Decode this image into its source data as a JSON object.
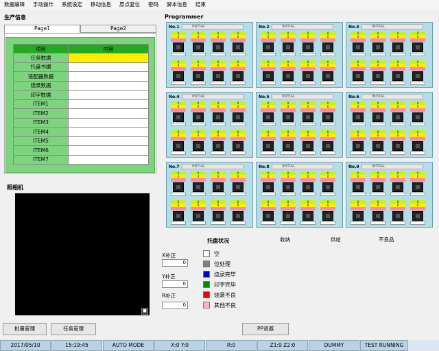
{
  "menu": [
    "数据编辑",
    "手动操作",
    "系统设定",
    "移动信息",
    "原点复位",
    "密码",
    "脚本信息",
    "结束"
  ],
  "production": {
    "title": "生产信息",
    "tabs": [
      "Page1",
      "Page2"
    ],
    "head_item": "项目",
    "head_content": "内容",
    "rows": [
      "任务数据",
      "托盘书据",
      "适配器数据",
      "烧录数据",
      "印字数据",
      "ITEM1",
      "ITEM2",
      "ITEM3",
      "ITEM4",
      "ITEM5",
      "ITEM6",
      "ITEM7"
    ]
  },
  "camera": {
    "title": "照相机",
    "icon": "save-icon"
  },
  "programmer": {
    "title": "Programmer",
    "units": [
      "No.1",
      "No.2",
      "No.3",
      "No.4",
      "No.5",
      "No.6",
      "No.7",
      "No.8",
      "No.9"
    ],
    "initial": "INITIAL",
    "socket_val": "0"
  },
  "tray_status": {
    "title": "托盘状况",
    "cols": [
      "收纳",
      "供给",
      "不良品"
    ],
    "legend": [
      {
        "label": "空",
        "color": "#ffffff"
      },
      {
        "label": "位处理",
        "color": "#808080"
      },
      {
        "label": "烧录完毕",
        "color": "#0000cc"
      },
      {
        "label": "印字完毕",
        "color": "#008800"
      },
      {
        "label": "烧录不良",
        "color": "#ee0000"
      },
      {
        "label": "其他不良",
        "color": "#ffb0c0"
      }
    ]
  },
  "offsets": {
    "x_label": "X补正",
    "x_val": "0",
    "y_label": "Y补正",
    "y_val": "0",
    "r_label": "R补正",
    "r_val": "0"
  },
  "buttons": {
    "batch": "批量管理",
    "task": "任务管理",
    "pp": "PP退避"
  },
  "status": [
    "2017/05/10",
    "15:19:45",
    "AUTO MODE",
    "X:0 Y:0",
    "R:0",
    "Z1:0 Z2:0",
    "DUMMY",
    "TEST RUNNING"
  ]
}
